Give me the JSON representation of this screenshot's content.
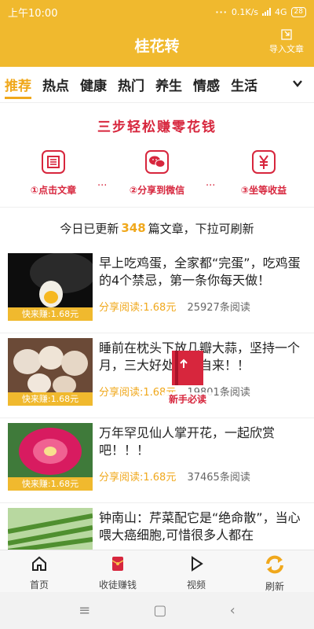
{
  "status": {
    "time": "上午10:00",
    "dots": "···",
    "speed": "0.1K/s",
    "network": "4G",
    "battery": "28"
  },
  "appbar": {
    "title": "桂花转",
    "import_label": "导入文章"
  },
  "tabs": [
    "推荐",
    "热点",
    "健康",
    "热门",
    "养生",
    "情感",
    "生活"
  ],
  "banner": {
    "headline": "三步轻松赚零花钱",
    "steps": [
      "①点击文章",
      "②分享到微信",
      "③坐等收益"
    ],
    "separator": "···"
  },
  "update": {
    "prefix": "今日已更新",
    "count": "348",
    "suffix": "篇文章，下拉可刷新"
  },
  "articles": [
    {
      "title": "早上吃鸡蛋，全家都“完蛋”，吃鸡蛋的4个禁忌，第一条你每天做！",
      "earn": "分享阅读:1.68元",
      "reads": "25927条阅读",
      "tag": "快来赚:1.68元"
    },
    {
      "title": "睡前在枕头下放几瓣大蒜，坚持一个月，三大好处不请自来！！",
      "earn": "分享阅读:1.68元",
      "reads": "19801条阅读",
      "tag": "快来赚:1.68元"
    },
    {
      "title": "万年罕见仙人掌开花，一起欣赏吧！！！",
      "earn": "分享阅读:1.68元",
      "reads": "37465条阅读",
      "tag": "快来赚:1.68元"
    },
    {
      "title": "钟南山：芹菜配它是“绝命散”，当心喂大癌细胞,可惜很多人都在",
      "earn": "",
      "reads": "",
      "tag": ""
    }
  ],
  "newbie": {
    "label": "新手必读"
  },
  "bottomnav": [
    "首页",
    "收徒赚钱",
    "视频",
    "刷新"
  ],
  "sysnav": {
    "menu": "≡",
    "home": "▢",
    "back": "‹"
  },
  "colors": {
    "primary": "#F0B92E",
    "accent": "#F0A81C",
    "red": "#D7263D"
  }
}
